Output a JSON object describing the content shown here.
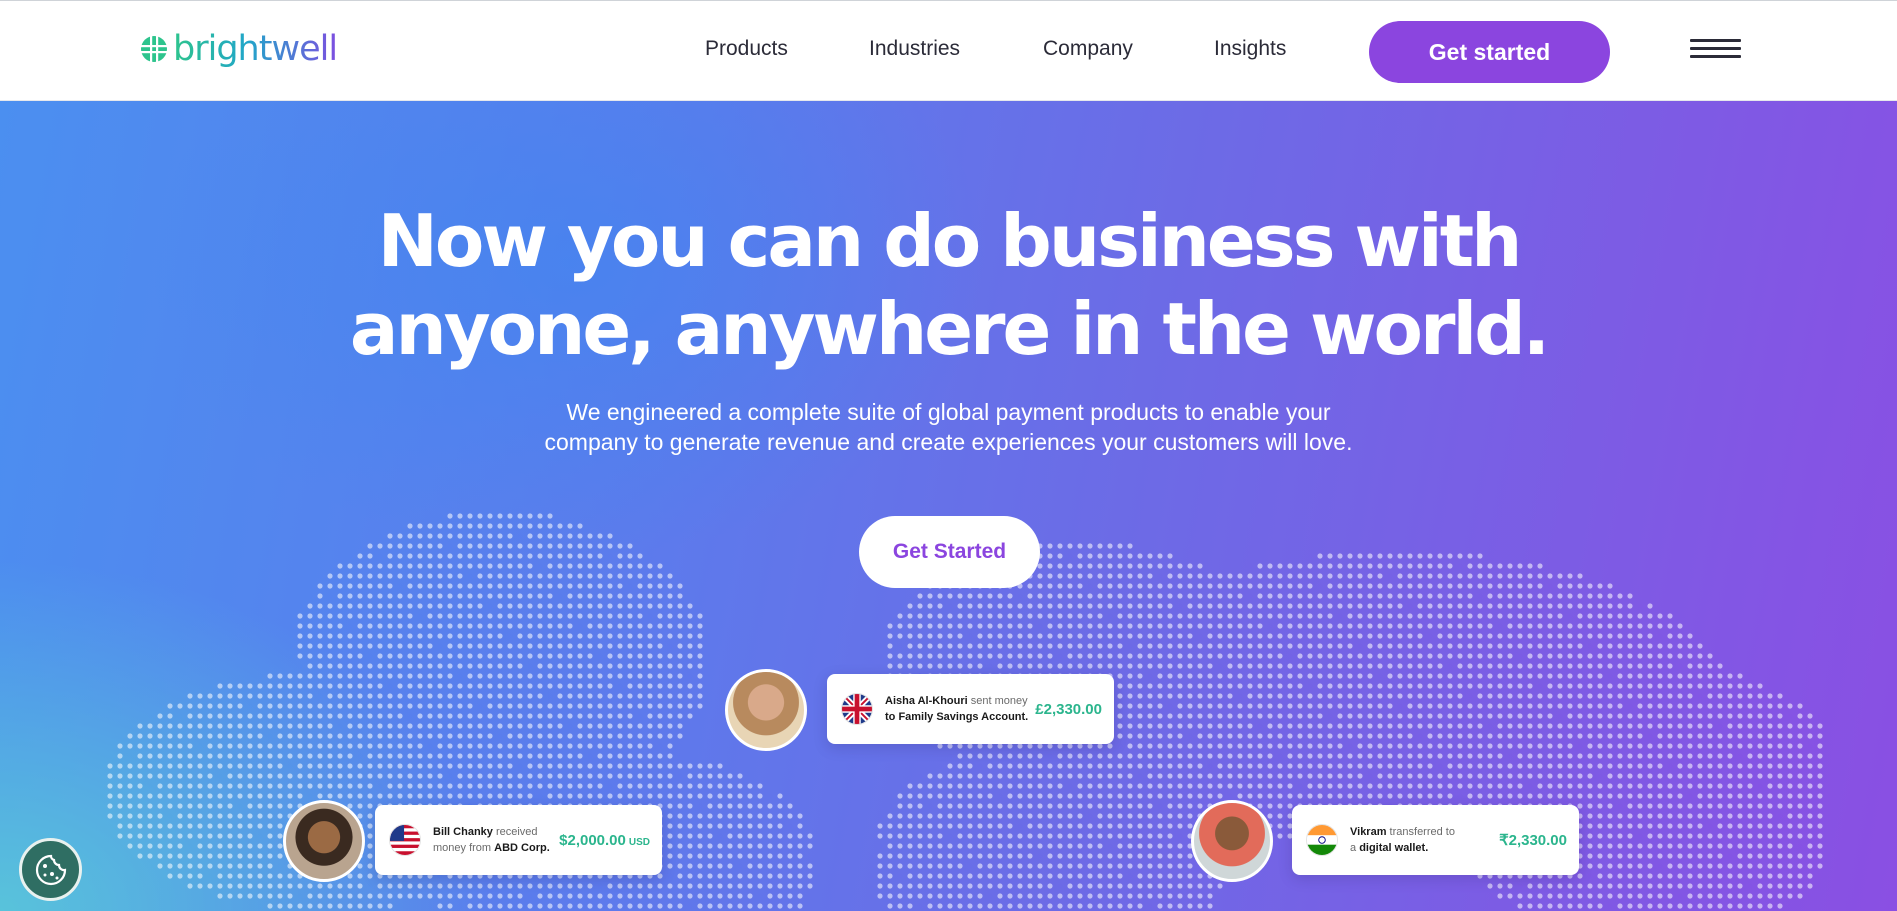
{
  "header": {
    "logo_text": "brightwell",
    "nav": [
      "Products",
      "Industries",
      "Company",
      "Insights"
    ],
    "cta_label": "Get started"
  },
  "hero": {
    "headline_line1": "Now you can do business with",
    "headline_line2": "anyone, anywhere in the world.",
    "subtitle_line1": "We engineered a complete suite of global payment products to enable your",
    "subtitle_line2": "company to generate revenue and create experiences your customers will love.",
    "cta_label": "Get Started"
  },
  "cards": [
    {
      "name_bold": "Aisha Al-Khouri",
      "action": " sent money",
      "line2": "to Family Savings Account.",
      "amount": "£2,330.00",
      "currency": "",
      "flag": "uk-flag-icon"
    },
    {
      "name_bold": "Bill Chanky",
      "action": " received",
      "line2_pre": "money from ",
      "line2_bold": "ABD Corp.",
      "amount": "$2,000.00",
      "currency": "USD",
      "flag": "us-flag-icon"
    },
    {
      "name_bold": "Vikram",
      "action": " transferred to",
      "line2_pre": "a ",
      "line2_bold": "digital wallet.",
      "amount": "₹2,330.00",
      "currency": "",
      "flag": "india-flag-icon"
    }
  ],
  "colors": {
    "brand_purple": "#8b45df",
    "amount_green": "#2bb58d",
    "hero_start": "#4b8ff0",
    "hero_end": "#8a4fe3"
  }
}
